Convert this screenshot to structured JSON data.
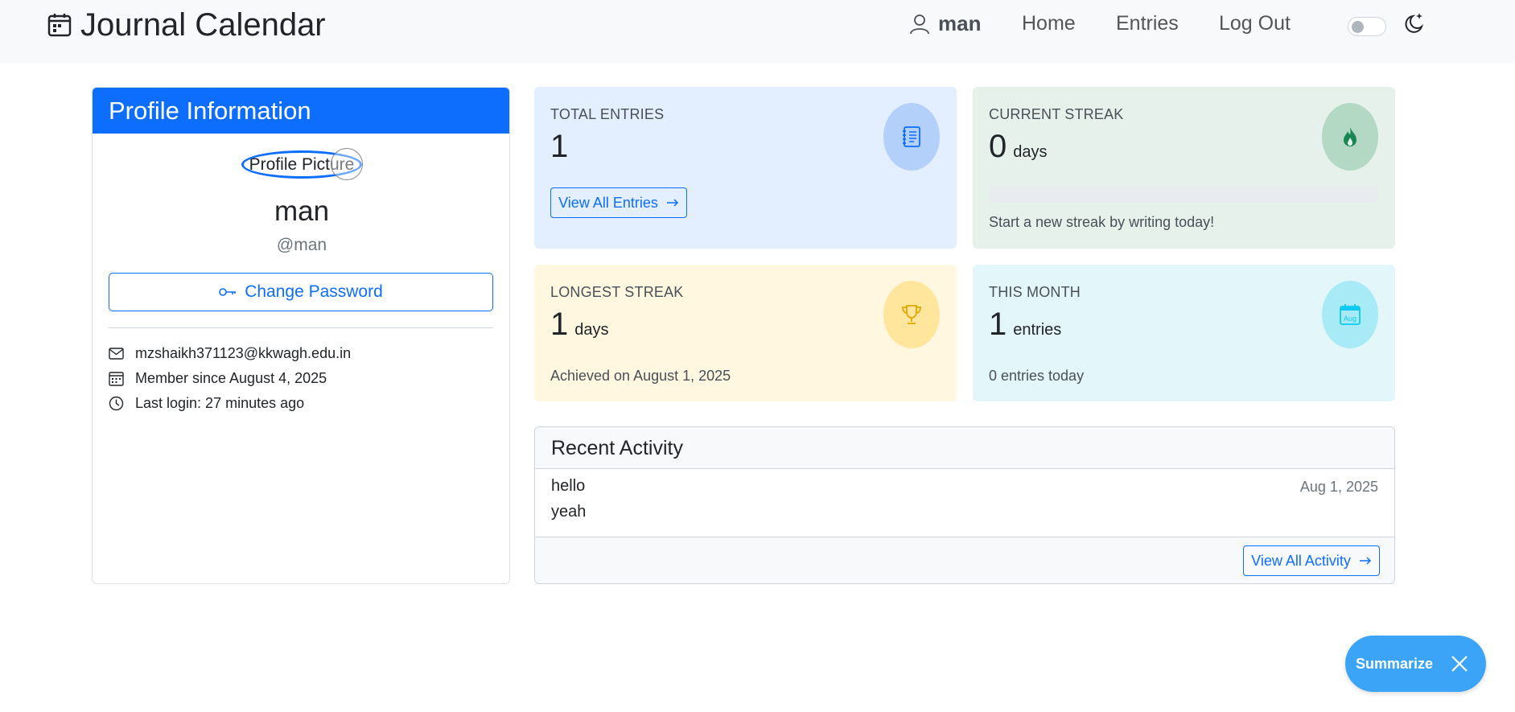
{
  "nav": {
    "brand": "Journal Calendar",
    "username": "man",
    "links": [
      "Home",
      "Entries",
      "Log Out"
    ]
  },
  "profile": {
    "header": "Profile Information",
    "avatar_alt": "Profile Picture",
    "name": "man",
    "handle": "@man",
    "change_password": "Change Password",
    "email": "mzshaikh371123@kkwagh.edu.in",
    "member_since": "Member since August 4, 2025",
    "last_login": "Last login: 27 minutes ago"
  },
  "stats": {
    "total": {
      "label": "TOTAL ENTRIES",
      "value": "1",
      "button": "View All Entries"
    },
    "current": {
      "label": "CURRENT STREAK",
      "value": "0",
      "unit": "days",
      "progress": 0,
      "note": "Start a new streak by writing today!"
    },
    "longest": {
      "label": "LONGEST STREAK",
      "value": "1",
      "unit": "days",
      "note": "Achieved on August 1, 2025"
    },
    "month": {
      "label": "THIS MONTH",
      "value": "1",
      "unit": "entries",
      "note": "0 entries today",
      "icon_text": "Aug"
    }
  },
  "activity": {
    "title": "Recent Activity",
    "items": [
      {
        "title": "hello",
        "body": "yeah",
        "date": "Aug 1, 2025"
      }
    ],
    "button": "View All Activity"
  },
  "fab": {
    "label": "Summarize"
  },
  "colors": {
    "primary": "#0d6efd",
    "total_bg": "#e3eefe",
    "current_bg": "#e5f1ea",
    "longest_bg": "#fff7e0",
    "month_bg": "#e3f7fb",
    "fab": "#3ba4f6"
  }
}
